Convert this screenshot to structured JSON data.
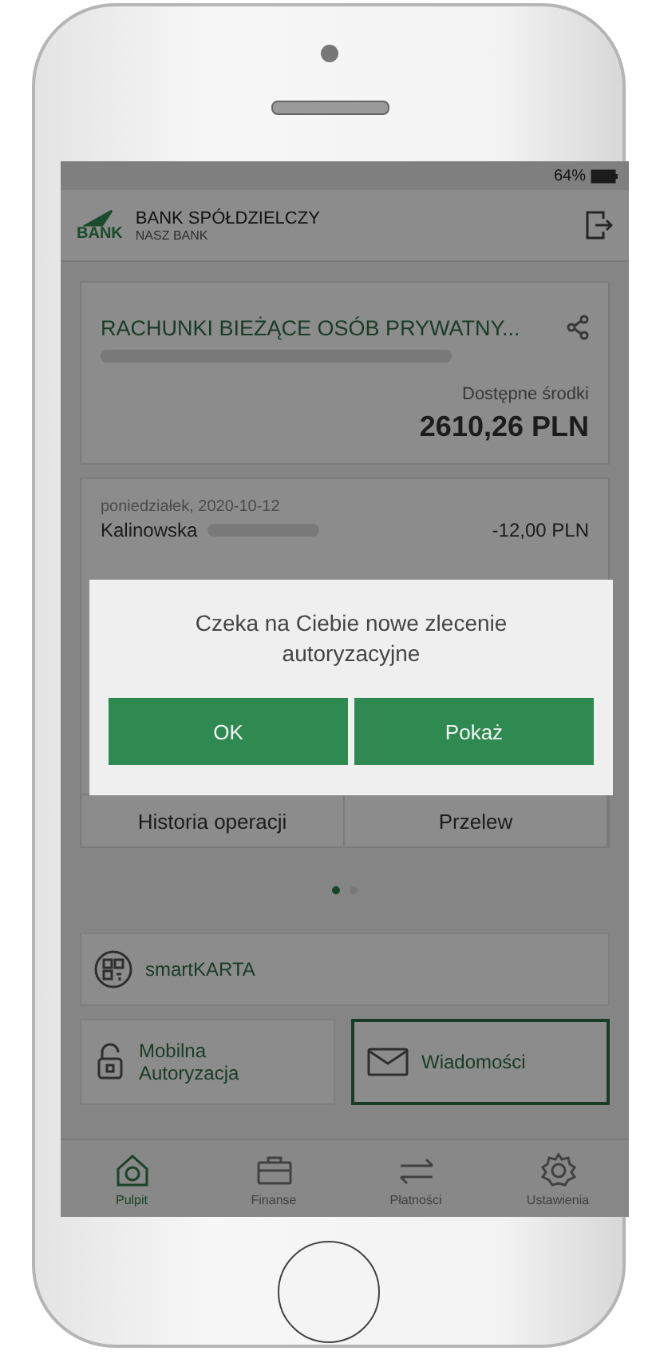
{
  "status_bar": {
    "battery": "64%"
  },
  "header": {
    "logo_text": "BANK",
    "bank_name": "BANK SPÓŁDZIELCZY",
    "bank_subname": "NASZ BANK"
  },
  "account": {
    "title": "RACHUNKI BIEŻĄCE OSÓB PRYWATNY...",
    "balance_label": "Dostępne środki",
    "balance": "2610,26 PLN"
  },
  "transactions": {
    "date": "poniedziałek, 2020-10-12",
    "rows": [
      {
        "name": "Kalinowska",
        "amount": "-12,00 PLN"
      }
    ],
    "actions": [
      "Historia operacji",
      "Przelew"
    ]
  },
  "pager": [
    {
      "selected": true
    },
    {
      "selected": false
    }
  ],
  "shortcuts": [
    {
      "kind": "wide",
      "label": "smartKARTA",
      "selected": false
    },
    {
      "kind": "half",
      "label": "Mobilna Autoryzacja",
      "selected": false
    },
    {
      "kind": "half",
      "label": "Wiadomości",
      "selected": true
    }
  ],
  "nav": [
    {
      "label": "Pulpit",
      "selected": true
    },
    {
      "label": "Finanse",
      "selected": false
    },
    {
      "label": "Płatności",
      "selected": false
    },
    {
      "label": "Ustawienia",
      "selected": false
    }
  ],
  "dialog": {
    "message": "Czeka na Ciebie nowe zlecenie autoryzacyjne",
    "buttons": [
      "OK",
      "Pokaż"
    ]
  }
}
